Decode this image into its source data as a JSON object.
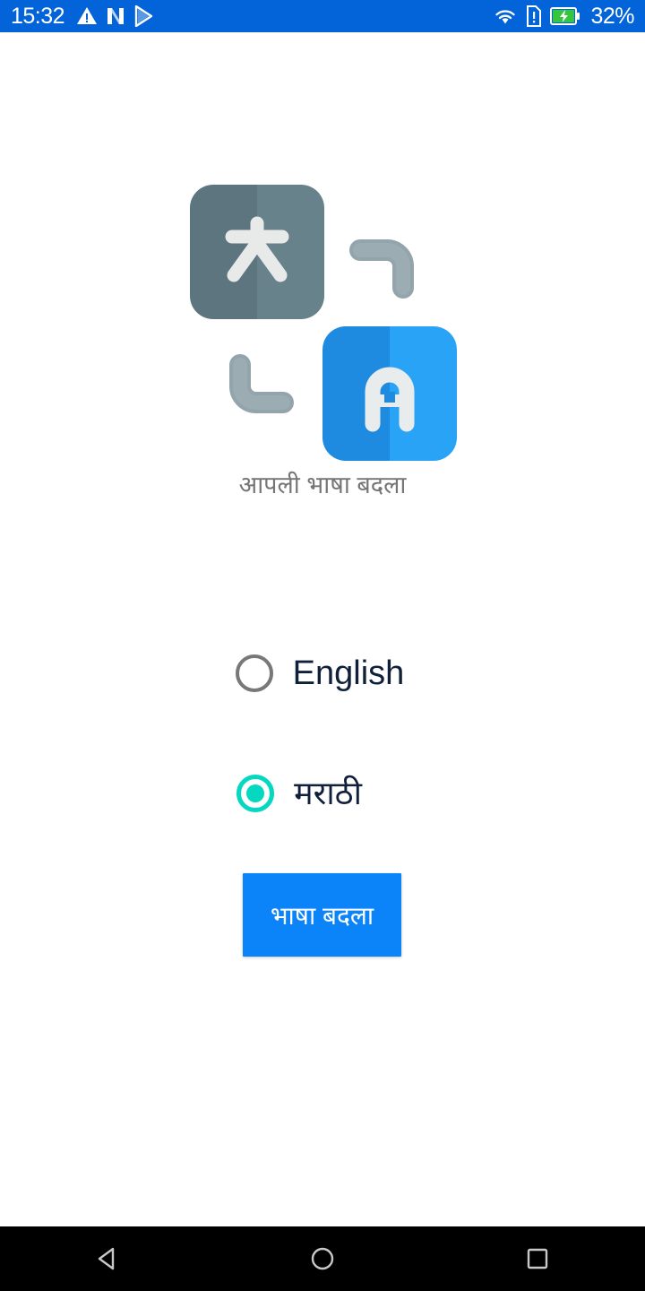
{
  "status_bar": {
    "time": "15:32",
    "battery_percent": "32%",
    "background_color": "#0264d8",
    "left_icons": [
      {
        "name": "warning-triangle-icon",
        "glyph": "warning"
      },
      {
        "name": "netflix-n-icon",
        "glyph": "n-logo"
      },
      {
        "name": "play-store-icon",
        "glyph": "play-triangle"
      }
    ],
    "right_icons": [
      {
        "name": "wifi-icon",
        "glyph": "wifi"
      },
      {
        "name": "sim-alert-icon",
        "glyph": "sim-card-alert"
      },
      {
        "name": "battery-charging-icon",
        "glyph": "battery-charging"
      }
    ]
  },
  "hero": {
    "icon_name": "translate-language-icon",
    "source_tile": {
      "character": "文",
      "color_left": "#5d757f",
      "color_right": "#68828c",
      "glyph_color": "#e8eaea"
    },
    "target_tile": {
      "character": "A",
      "color_left": "#1e8ae0",
      "color_right": "#29a3f5",
      "glyph_color": "#e9ecec"
    },
    "arc_color": "#93a4ac",
    "subtitle": "आपली भाषा बदला"
  },
  "language_options": [
    {
      "id": "english",
      "label": "English",
      "selected": false,
      "script": "latin"
    },
    {
      "id": "marathi",
      "label": "मराठी",
      "selected": true,
      "script": "devanagari"
    }
  ],
  "radio": {
    "selected_color": "#05d8c0",
    "unselected_color": "#787878"
  },
  "primary_button": {
    "label": "भाषा बदला",
    "background_color": "#0b84fa",
    "text_color": "#ffffff"
  },
  "nav_bar": {
    "background_color": "#000000",
    "buttons": [
      {
        "name": "back-button",
        "glyph": "triangle-left"
      },
      {
        "name": "home-button",
        "glyph": "circle"
      },
      {
        "name": "recents-button",
        "glyph": "square"
      }
    ]
  }
}
